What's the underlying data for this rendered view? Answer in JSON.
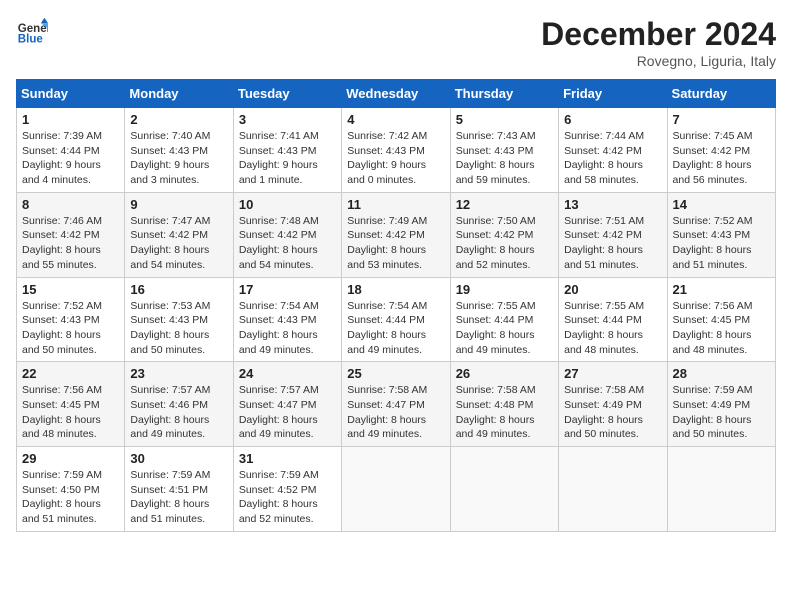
{
  "header": {
    "logo_line1": "General",
    "logo_line2": "Blue",
    "month": "December 2024",
    "location": "Rovegno, Liguria, Italy"
  },
  "weekdays": [
    "Sunday",
    "Monday",
    "Tuesday",
    "Wednesday",
    "Thursday",
    "Friday",
    "Saturday"
  ],
  "weeks": [
    [
      {
        "day": "1",
        "info": "Sunrise: 7:39 AM\nSunset: 4:44 PM\nDaylight: 9 hours\nand 4 minutes."
      },
      {
        "day": "2",
        "info": "Sunrise: 7:40 AM\nSunset: 4:43 PM\nDaylight: 9 hours\nand 3 minutes."
      },
      {
        "day": "3",
        "info": "Sunrise: 7:41 AM\nSunset: 4:43 PM\nDaylight: 9 hours\nand 1 minute."
      },
      {
        "day": "4",
        "info": "Sunrise: 7:42 AM\nSunset: 4:43 PM\nDaylight: 9 hours\nand 0 minutes."
      },
      {
        "day": "5",
        "info": "Sunrise: 7:43 AM\nSunset: 4:43 PM\nDaylight: 8 hours\nand 59 minutes."
      },
      {
        "day": "6",
        "info": "Sunrise: 7:44 AM\nSunset: 4:42 PM\nDaylight: 8 hours\nand 58 minutes."
      },
      {
        "day": "7",
        "info": "Sunrise: 7:45 AM\nSunset: 4:42 PM\nDaylight: 8 hours\nand 56 minutes."
      }
    ],
    [
      {
        "day": "8",
        "info": "Sunrise: 7:46 AM\nSunset: 4:42 PM\nDaylight: 8 hours\nand 55 minutes."
      },
      {
        "day": "9",
        "info": "Sunrise: 7:47 AM\nSunset: 4:42 PM\nDaylight: 8 hours\nand 54 minutes."
      },
      {
        "day": "10",
        "info": "Sunrise: 7:48 AM\nSunset: 4:42 PM\nDaylight: 8 hours\nand 54 minutes."
      },
      {
        "day": "11",
        "info": "Sunrise: 7:49 AM\nSunset: 4:42 PM\nDaylight: 8 hours\nand 53 minutes."
      },
      {
        "day": "12",
        "info": "Sunrise: 7:50 AM\nSunset: 4:42 PM\nDaylight: 8 hours\nand 52 minutes."
      },
      {
        "day": "13",
        "info": "Sunrise: 7:51 AM\nSunset: 4:42 PM\nDaylight: 8 hours\nand 51 minutes."
      },
      {
        "day": "14",
        "info": "Sunrise: 7:52 AM\nSunset: 4:43 PM\nDaylight: 8 hours\nand 51 minutes."
      }
    ],
    [
      {
        "day": "15",
        "info": "Sunrise: 7:52 AM\nSunset: 4:43 PM\nDaylight: 8 hours\nand 50 minutes."
      },
      {
        "day": "16",
        "info": "Sunrise: 7:53 AM\nSunset: 4:43 PM\nDaylight: 8 hours\nand 50 minutes."
      },
      {
        "day": "17",
        "info": "Sunrise: 7:54 AM\nSunset: 4:43 PM\nDaylight: 8 hours\nand 49 minutes."
      },
      {
        "day": "18",
        "info": "Sunrise: 7:54 AM\nSunset: 4:44 PM\nDaylight: 8 hours\nand 49 minutes."
      },
      {
        "day": "19",
        "info": "Sunrise: 7:55 AM\nSunset: 4:44 PM\nDaylight: 8 hours\nand 49 minutes."
      },
      {
        "day": "20",
        "info": "Sunrise: 7:55 AM\nSunset: 4:44 PM\nDaylight: 8 hours\nand 48 minutes."
      },
      {
        "day": "21",
        "info": "Sunrise: 7:56 AM\nSunset: 4:45 PM\nDaylight: 8 hours\nand 48 minutes."
      }
    ],
    [
      {
        "day": "22",
        "info": "Sunrise: 7:56 AM\nSunset: 4:45 PM\nDaylight: 8 hours\nand 48 minutes."
      },
      {
        "day": "23",
        "info": "Sunrise: 7:57 AM\nSunset: 4:46 PM\nDaylight: 8 hours\nand 49 minutes."
      },
      {
        "day": "24",
        "info": "Sunrise: 7:57 AM\nSunset: 4:47 PM\nDaylight: 8 hours\nand 49 minutes."
      },
      {
        "day": "25",
        "info": "Sunrise: 7:58 AM\nSunset: 4:47 PM\nDaylight: 8 hours\nand 49 minutes."
      },
      {
        "day": "26",
        "info": "Sunrise: 7:58 AM\nSunset: 4:48 PM\nDaylight: 8 hours\nand 49 minutes."
      },
      {
        "day": "27",
        "info": "Sunrise: 7:58 AM\nSunset: 4:49 PM\nDaylight: 8 hours\nand 50 minutes."
      },
      {
        "day": "28",
        "info": "Sunrise: 7:59 AM\nSunset: 4:49 PM\nDaylight: 8 hours\nand 50 minutes."
      }
    ],
    [
      {
        "day": "29",
        "info": "Sunrise: 7:59 AM\nSunset: 4:50 PM\nDaylight: 8 hours\nand 51 minutes."
      },
      {
        "day": "30",
        "info": "Sunrise: 7:59 AM\nSunset: 4:51 PM\nDaylight: 8 hours\nand 51 minutes."
      },
      {
        "day": "31",
        "info": "Sunrise: 7:59 AM\nSunset: 4:52 PM\nDaylight: 8 hours\nand 52 minutes."
      },
      null,
      null,
      null,
      null
    ]
  ]
}
